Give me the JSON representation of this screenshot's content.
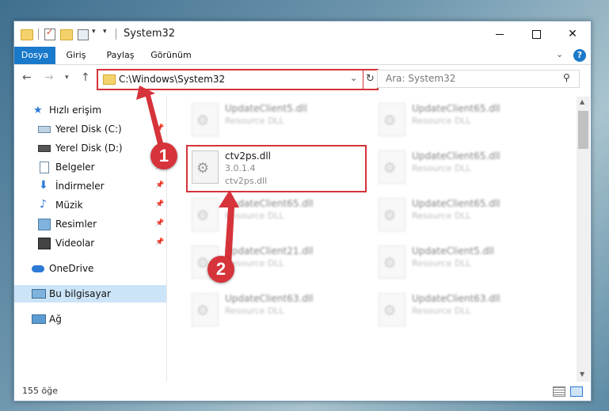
{
  "window": {
    "title": "System32",
    "quick_access_icons": [
      "folder-icon",
      "properties-check-icon",
      "new-folder-icon",
      "properties-icon",
      "dropdown-icon"
    ]
  },
  "ribbon": {
    "tabs": [
      {
        "label": "Dosya",
        "active": true
      },
      {
        "label": "Giriş",
        "active": false
      },
      {
        "label": "Paylaş",
        "active": false
      },
      {
        "label": "Görünüm",
        "active": false
      }
    ],
    "help_label": "?"
  },
  "navigation": {
    "address": "C:\\Windows\\System32",
    "search_placeholder": "Ara: System32"
  },
  "sidebar": {
    "items": [
      {
        "label": "Hızlı erişim",
        "icon": "star-icon",
        "pinned": false
      },
      {
        "label": "Yerel Disk (C:)",
        "icon": "drive-icon",
        "pinned": true
      },
      {
        "label": "Yerel Disk (D:)",
        "icon": "drive-icon",
        "pinned": true
      },
      {
        "label": "Belgeler",
        "icon": "documents-icon",
        "pinned": true
      },
      {
        "label": "İndirmeler",
        "icon": "download-icon",
        "pinned": true
      },
      {
        "label": "Müzik",
        "icon": "music-icon",
        "pinned": true
      },
      {
        "label": "Resimler",
        "icon": "pictures-icon",
        "pinned": true
      },
      {
        "label": "Videolar",
        "icon": "video-icon",
        "pinned": true
      },
      {
        "label": "OneDrive",
        "icon": "cloud-icon",
        "pinned": false
      },
      {
        "label": "Bu bilgisayar",
        "icon": "computer-icon",
        "pinned": false,
        "selected": true
      },
      {
        "label": "Ağ",
        "icon": "network-icon",
        "pinned": false
      }
    ]
  },
  "files": {
    "left": [
      {
        "name": "UpdateClient5.dll",
        "sub": "Resource DLL",
        "sub2": ""
      },
      {
        "name": "ctv2ps.dll",
        "sub": "3.0.1.4",
        "sub2": "ctv2ps.dll",
        "highlighted": true
      },
      {
        "name": "UpdateClient65.dll",
        "sub": "Resource DLL",
        "sub2": ""
      },
      {
        "name": "UpdateClient21.dll",
        "sub": "Resource DLL",
        "sub2": ""
      },
      {
        "name": "UpdateClient63.dll",
        "sub": "Resource DLL",
        "sub2": ""
      }
    ],
    "right": [
      {
        "name": "UpdateClient65.dll",
        "sub": "Resource DLL"
      },
      {
        "name": "UpdateClient65.dll",
        "sub": "Resource DLL"
      },
      {
        "name": "UpdateClient65.dll",
        "sub": "Resource DLL"
      },
      {
        "name": "UpdateClient5.dll",
        "sub": "Resource DLL"
      },
      {
        "name": "UpdateClient63.dll",
        "sub": "Resource DLL"
      }
    ]
  },
  "status": {
    "item_count": "155 öğe"
  },
  "annotations": {
    "step1": "1",
    "step2": "2",
    "color": "#d6333a"
  }
}
